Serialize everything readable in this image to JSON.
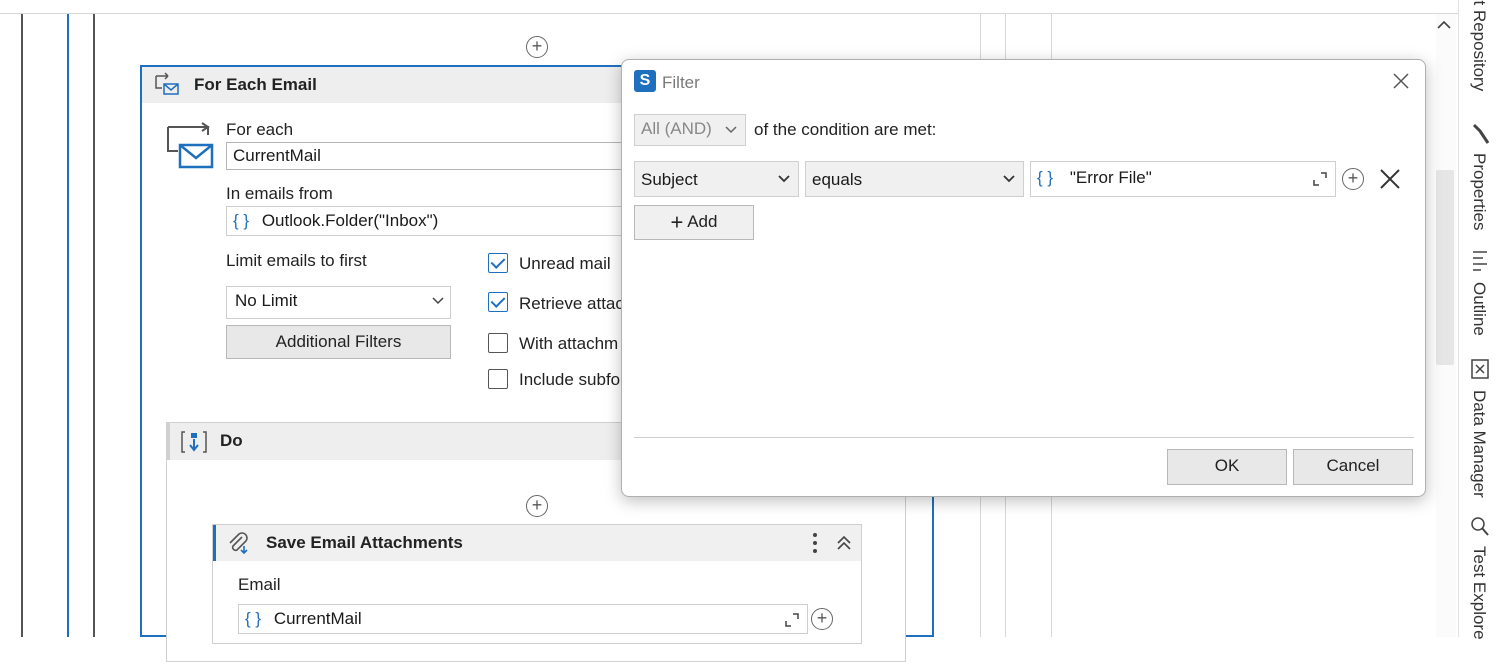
{
  "workflow": {
    "for_each_email": {
      "title": "For Each Email",
      "for_each_label": "For each",
      "for_each_value": "CurrentMail",
      "in_emails_from_label": "In emails from",
      "in_emails_from_value": "Outlook.Folder(\"Inbox\")",
      "limit_label": "Limit emails to first",
      "limit_value": "No Limit",
      "additional_filters_label": "Additional Filters",
      "options": [
        {
          "label": "Unread mail",
          "checked": true
        },
        {
          "label": "Retrieve attac",
          "checked": true
        },
        {
          "label": "With attachm",
          "checked": false
        },
        {
          "label": "Include subfo",
          "checked": false
        }
      ]
    },
    "do_block": {
      "title": "Do"
    },
    "save_attachments": {
      "title": "Save Email Attachments",
      "email_label": "Email",
      "email_value": "CurrentMail"
    }
  },
  "filter_dialog": {
    "title": "Filter",
    "mode_value": "All (AND)",
    "mode_suffix": "of the condition are met:",
    "condition": {
      "field": "Subject",
      "operator": "equals",
      "value": "\"Error File\""
    },
    "add_label": "Add",
    "ok_label": "OK",
    "cancel_label": "Cancel"
  },
  "side_panel": {
    "tabs": [
      "ct Repository",
      "Properties",
      "Outline",
      "Data Manager",
      "Test Explore"
    ]
  },
  "icons": {
    "braces": "{}",
    "plus": "+"
  },
  "colors": {
    "accent": "#1f6fbf",
    "dialog_logo": "#1f6fbf"
  }
}
